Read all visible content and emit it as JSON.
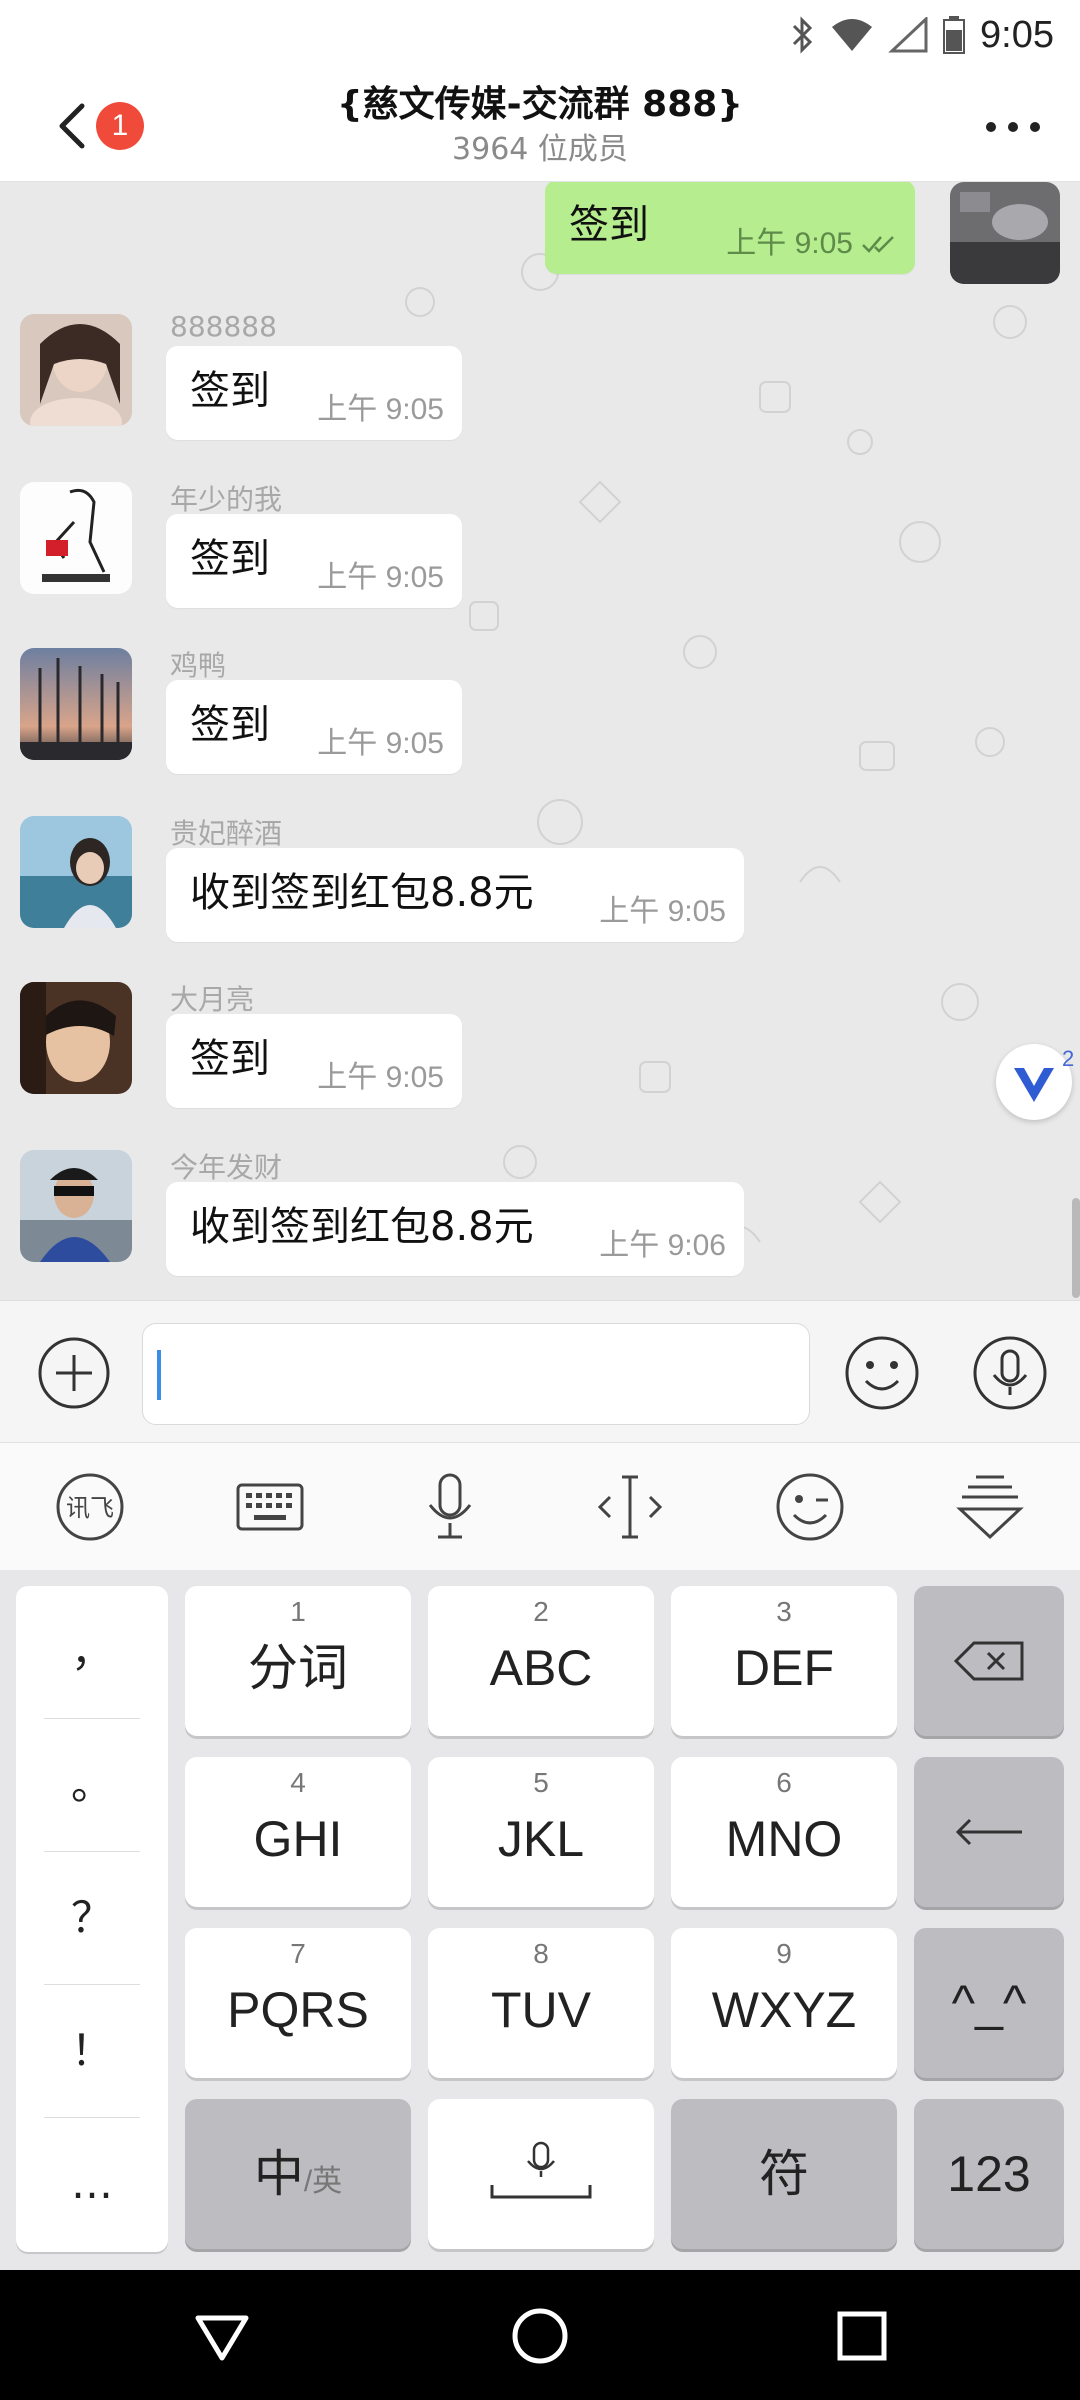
{
  "status_bar": {
    "time": "9:05"
  },
  "header": {
    "unread_badge": "1",
    "title": "{慈文传媒-交流群 888}",
    "member_count": "3964 位成员"
  },
  "messages": [
    {
      "sender": "",
      "text": "签到",
      "time": "上午  9:05",
      "own": true
    },
    {
      "sender": "888888",
      "text": "签到",
      "time": "上午  9:05"
    },
    {
      "sender": "年少的我",
      "text": "签到",
      "time": "上午  9:05"
    },
    {
      "sender": "鸡鸭",
      "text": "签到",
      "time": "上午  9:05"
    },
    {
      "sender": "贵妃醉酒",
      "text": "收到签到红包8.8元",
      "time": "上午  9:05"
    },
    {
      "sender": "大月亮",
      "text": "签到",
      "time": "上午  9:05"
    },
    {
      "sender": "今年发财",
      "text": "收到签到红包8.8元",
      "time": "上午  9:06"
    }
  ],
  "floating_badge_count": "2",
  "input": {
    "value": "",
    "placeholder": ""
  },
  "keyboard": {
    "punctuation": [
      "，",
      "。",
      "？",
      "！",
      "…"
    ],
    "keys": [
      {
        "num": "1",
        "label": "分词"
      },
      {
        "num": "2",
        "label": "ABC"
      },
      {
        "num": "3",
        "label": "DEF"
      },
      {
        "num": "4",
        "label": "GHI"
      },
      {
        "num": "5",
        "label": "JKL"
      },
      {
        "num": "6",
        "label": "MNO"
      },
      {
        "num": "7",
        "label": "PQRS"
      },
      {
        "num": "8",
        "label": "TUV"
      },
      {
        "num": "9",
        "label": "WXYZ"
      }
    ],
    "emoticon_key": "^_^",
    "lang_key_main": "中",
    "lang_key_sub": "/英",
    "symbol_key": "符",
    "number_key": "123"
  },
  "colors": {
    "own_bubble": "#b6ed8e",
    "badge": "#f04a3a",
    "chat_background": "#e9e9ea"
  },
  "icons": [
    "bluetooth-icon",
    "wifi-icon",
    "signal-icon",
    "battery-icon",
    "back-icon",
    "more-icon",
    "plus-icon",
    "emoji-icon",
    "microphone-icon",
    "ifly-icon",
    "keyboard-icon",
    "cursor-icon",
    "wink-icon",
    "collapse-keyboard-icon",
    "backspace-icon",
    "enter-icon",
    "back-triangle-icon",
    "home-circle-icon",
    "recents-square-icon"
  ]
}
